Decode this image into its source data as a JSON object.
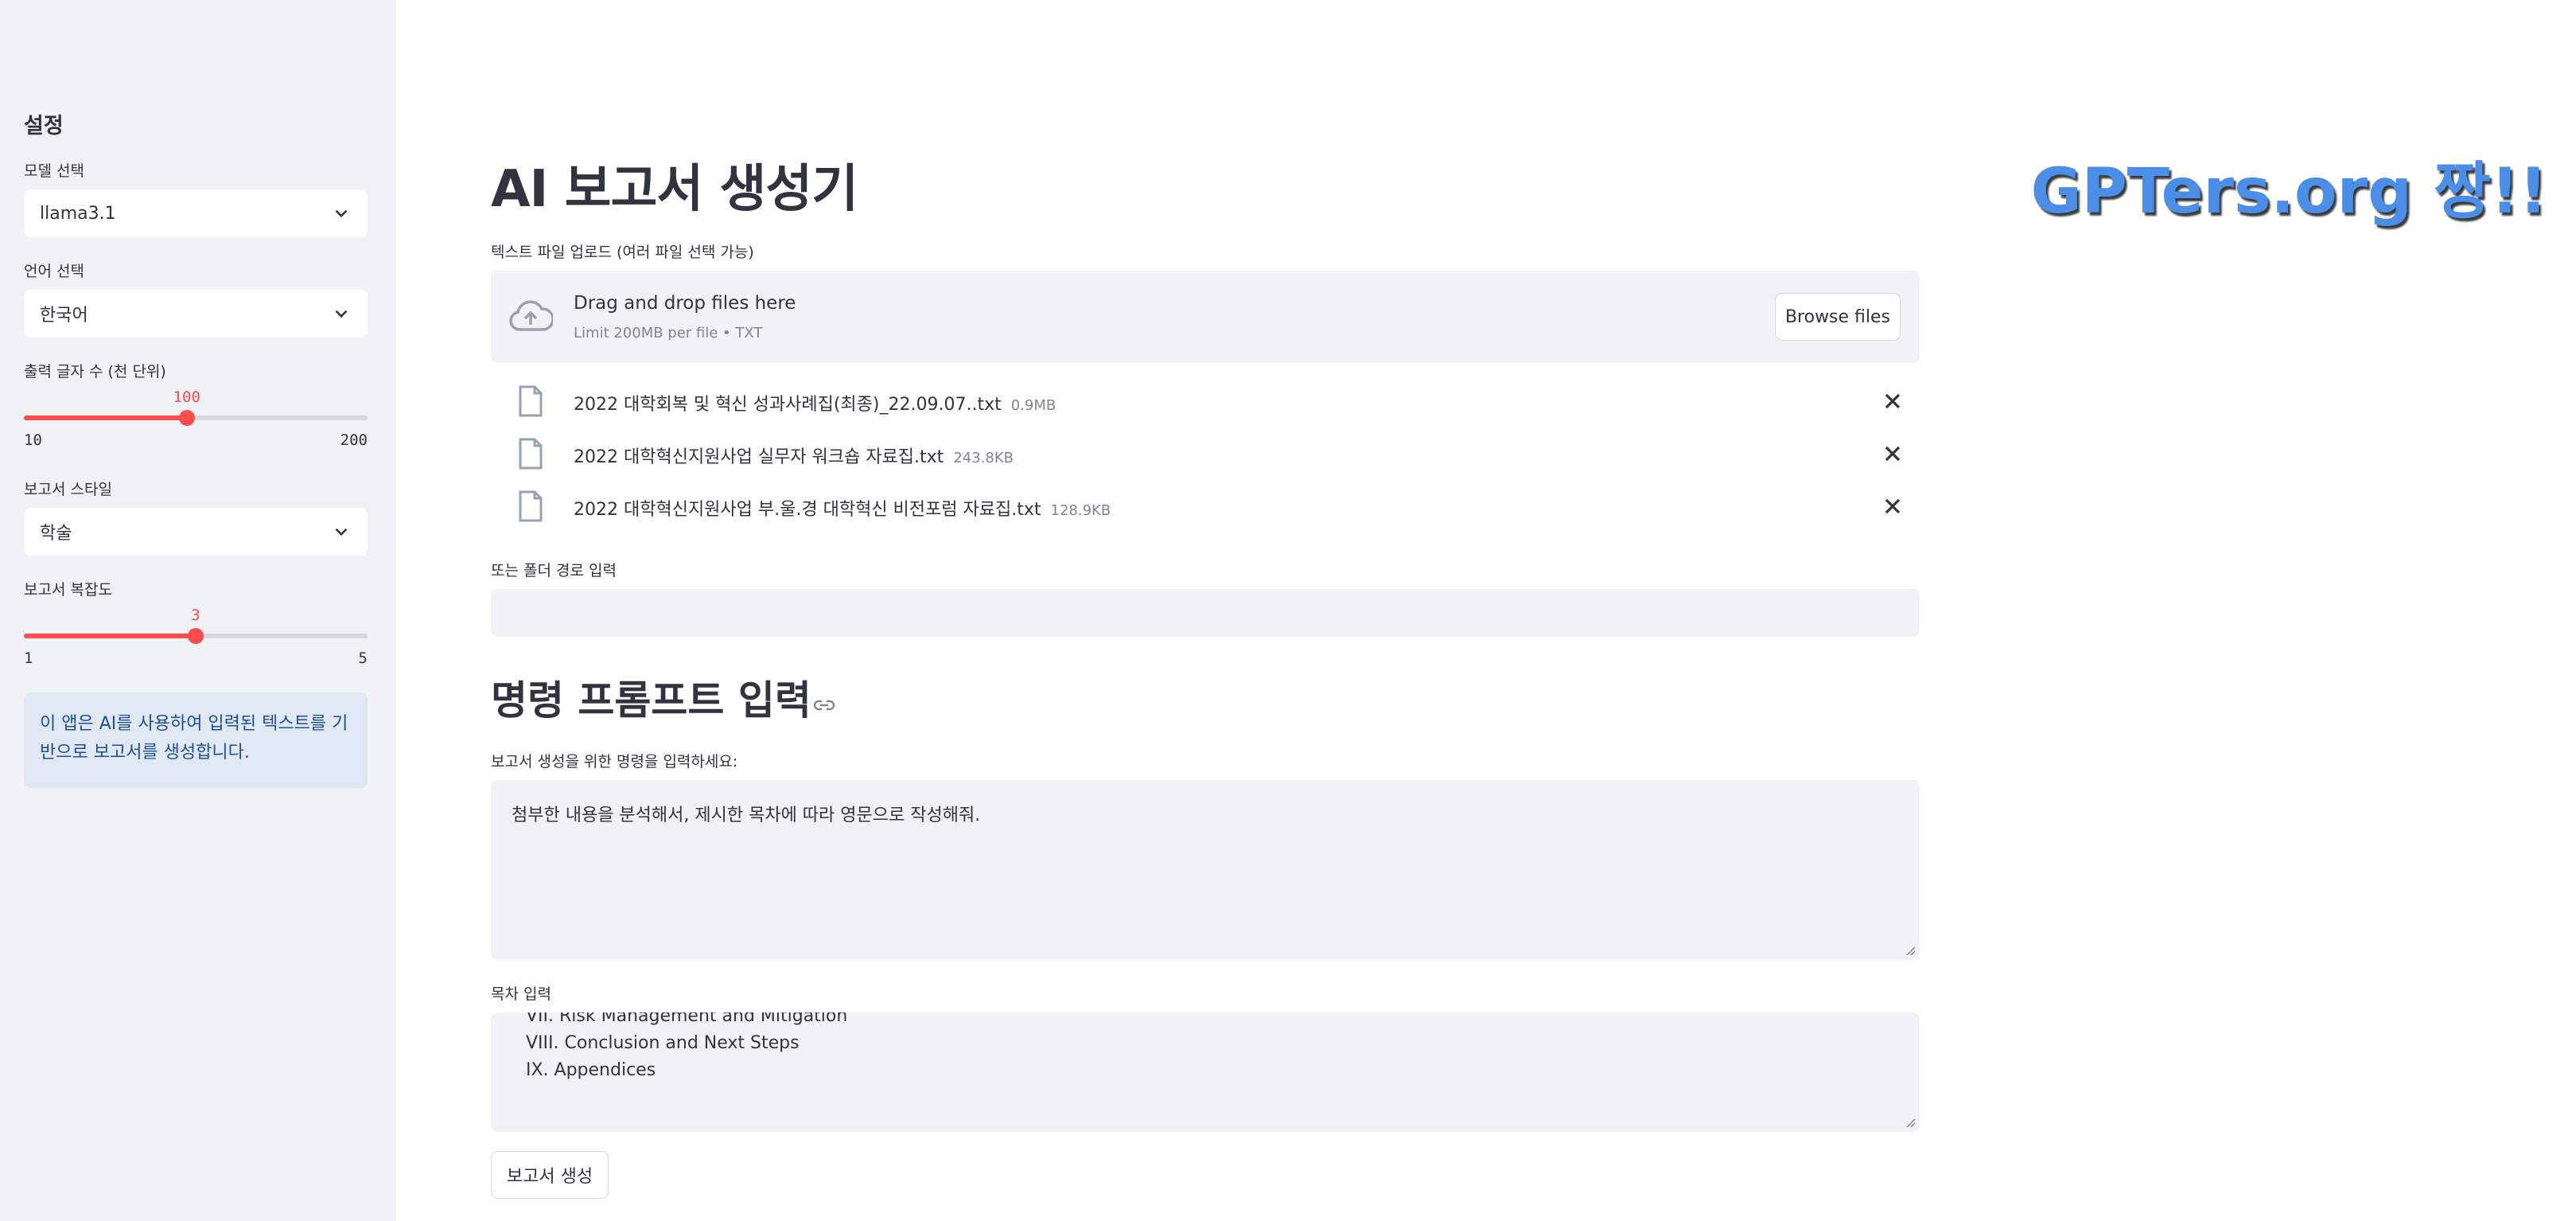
{
  "sidebar": {
    "title": "설정",
    "model": {
      "label": "모델 선택",
      "value": "llama3.1"
    },
    "language": {
      "label": "언어 선택",
      "value": "한국어"
    },
    "length": {
      "label": "출력 글자 수 (천 단위)",
      "value": "100",
      "min": "10",
      "max": "200"
    },
    "style": {
      "label": "보고서 스타일",
      "value": "학술"
    },
    "complexity": {
      "label": "보고서 복잡도",
      "value": "3",
      "min": "1",
      "max": "5"
    },
    "info": "이 앱은 AI를 사용하여 입력된 텍스트를 기반으로 보고서를 생성합니다."
  },
  "main": {
    "title": "AI 보고서 생성기",
    "brand": "GPTers.org 짱!!",
    "upload": {
      "label": "텍스트 파일 업로드 (여러 파일 선택 가능)",
      "drag_text": "Drag and drop files here",
      "limit_text": "Limit 200MB per file • TXT",
      "browse_label": "Browse files"
    },
    "files": [
      {
        "name": "2022 대학회복 및 혁신 성과사례집(최종)_22.09.07..txt",
        "size": "0.9MB"
      },
      {
        "name": "2022 대학혁신지원사업 실무자 워크숍 자료집.txt",
        "size": "243.8KB"
      },
      {
        "name": "2022 대학혁신지원사업 부.울.경 대학혁신 비전포럼 자료집.txt",
        "size": "128.9KB"
      }
    ],
    "folder": {
      "label": "또는 폴더 경로 입력",
      "value": ""
    },
    "prompt_section": {
      "heading": "명령 프롬프트 입력",
      "label": "보고서 생성을 위한 명령을 입력하세요:",
      "value": "첨부한 내용을 분석해서, 제시한 목차에 따라  영문으로 작성해줘."
    },
    "toc": {
      "label": "목차 입력",
      "lines": [
        "VII. Risk Management and Mitigation",
        "VIII. Conclusion and Next Steps",
        "IX. Appendices"
      ]
    },
    "generate_label": "보고서 생성"
  },
  "colors": {
    "accent": "#ff4b4b",
    "sidebar_bg": "#f0f2f6",
    "info_bg": "#dfe8f3",
    "brand": "#4a8ee8"
  }
}
